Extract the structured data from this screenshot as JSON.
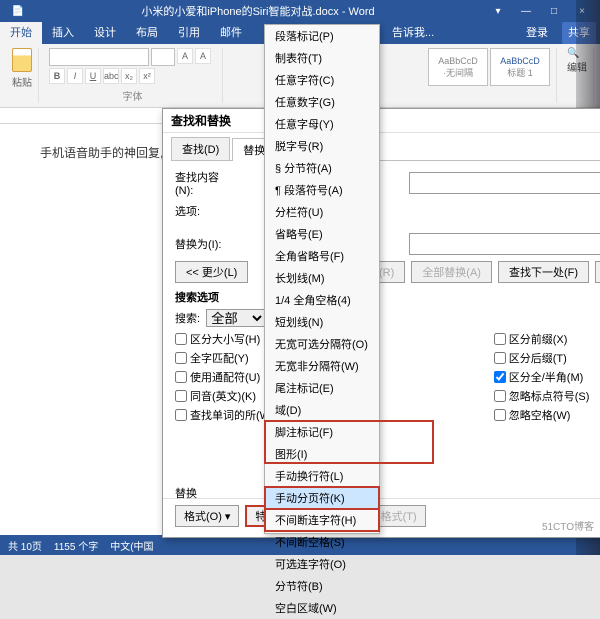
{
  "title": "小米的小爱和iPhone的Siri智能对战.docx - Word",
  "window": {
    "min": "—",
    "max": "□",
    "close": "×",
    "opts": "▾"
  },
  "tabs": {
    "start": "开始",
    "insert": "插入",
    "design": "设计",
    "layout": "布局",
    "ref": "引用",
    "mail": "邮件",
    "tell": "告诉我...",
    "login": "登录",
    "share": "共享"
  },
  "ribbon": {
    "paste": "粘贴",
    "font_name": "",
    "font_size": "",
    "font_group": "字体",
    "style1_sample": "AaBbCcD",
    "style1_name": "·无间隔",
    "style2_sample": "AaBbCcD",
    "style2_name": "标题 1",
    "edit": "编辑"
  },
  "document": {
    "line": "手机语音助手的神回复,"
  },
  "dialog": {
    "title": "查找和替换",
    "tabs": {
      "find": "查找(D)",
      "replace": "替换(P)"
    },
    "find_label": "查找内容(N):",
    "options_label": "选项:",
    "replace_label": "替换为(I):",
    "less_btn": "<< 更少(L)",
    "replace_btn": "替换(R)",
    "replace_all_btn": "全部替换(A)",
    "find_next_btn": "查找下一处(F)",
    "cancel_btn": "取消",
    "search_opts_hdr": "搜索选项",
    "search_label": "搜索:",
    "search_all": "全部",
    "chk_case": "区分大小写(H)",
    "chk_whole": "全字匹配(Y)",
    "chk_wild": "使用通配符(U)",
    "chk_homo": "同音(英文)(K)",
    "chk_forms": "查找单词的所(W)",
    "chk_prefix": "区分前缀(X)",
    "chk_suffix": "区分后缀(T)",
    "chk_full": "区分全/半角(M)",
    "chk_punct": "忽略标点符号(S)",
    "chk_space": "忽略空格(W)",
    "replace_section": "替换",
    "format_btn": "格式(O)",
    "special_btn": "特殊格式(E)",
    "noformat_btn": "不限定格式(T)"
  },
  "menu": {
    "items": [
      "段落标记(P)",
      "制表符(T)",
      "任意字符(C)",
      "任意数字(G)",
      "任意字母(Y)",
      "脱字号(R)",
      "§ 分节符(A)",
      "¶ 段落符号(A)",
      "分栏符(U)",
      "省略号(E)",
      "全角省略号(F)",
      "长划线(M)",
      "1/4 全角空格(4)",
      "短划线(N)",
      "无宽可选分隔符(O)",
      "无宽非分隔符(W)",
      "尾注标记(E)",
      "域(D)",
      "脚注标记(F)",
      "图形(I)",
      "手动换行符(L)",
      "手动分页符(K)",
      "不间断连字符(H)",
      "不间断空格(S)",
      "可选连字符(O)",
      "分节符(B)",
      "空白区域(W)"
    ]
  },
  "status": {
    "pages": "共 10页",
    "words": "1155 个字",
    "lang": "中文(中国"
  },
  "watermark": "51CTO博客"
}
